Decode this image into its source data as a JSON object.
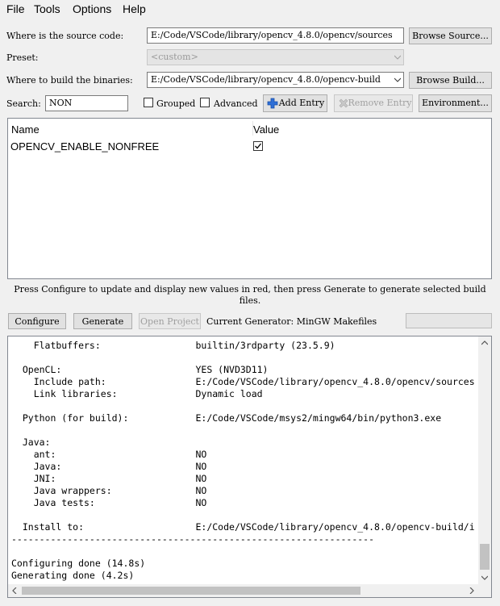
{
  "menu": [
    "File",
    "Tools",
    "Options",
    "Help"
  ],
  "source": {
    "label": "Where is the source code:",
    "value": "E:/Code/VSCode/library/opencv_4.8.0/opencv/sources",
    "browse": "Browse Source..."
  },
  "preset": {
    "label": "Preset:",
    "value": "<custom>"
  },
  "build": {
    "label": "Where to build the binaries:",
    "value": "E:/Code/VSCode/library/opencv_4.8.0/opencv-build",
    "browse": "Browse Build..."
  },
  "search": {
    "label": "Search:",
    "value": "NON"
  },
  "toolbar": {
    "grouped": "Grouped",
    "advanced": "Advanced",
    "add_entry": "Add Entry",
    "remove_entry": "Remove Entry",
    "environment": "Environment..."
  },
  "table": {
    "headers": [
      "Name",
      "Value"
    ],
    "rows": [
      {
        "name": "OPENCV_ENABLE_NONFREE",
        "checked": true
      }
    ]
  },
  "hint": "Press Configure to update and display new values in red, then press Generate to generate selected build files.",
  "actions": {
    "configure": "Configure",
    "generate": "Generate",
    "open_project": "Open Project",
    "generator": "Current Generator: MinGW Makefiles"
  },
  "output": [
    "    Flatbuffers:                 builtin/3rdparty (23.5.9)",
    "",
    "  OpenCL:                        YES (NVD3D11)",
    "    Include path:                E:/Code/VSCode/library/opencv_4.8.0/opencv/sources",
    "    Link libraries:              Dynamic load",
    "",
    "  Python (for build):            E:/Code/VSCode/msys2/mingw64/bin/python3.exe",
    "",
    "  Java:",
    "    ant:                         NO",
    "    Java:                        NO",
    "    JNI:                         NO",
    "    Java wrappers:               NO",
    "    Java tests:                  NO",
    "",
    "  Install to:                    E:/Code/VSCode/library/opencv_4.8.0/opencv-build/i",
    "-----------------------------------------------------------------",
    "",
    "Configuring done (14.8s)",
    "Generating done (4.2s)"
  ]
}
